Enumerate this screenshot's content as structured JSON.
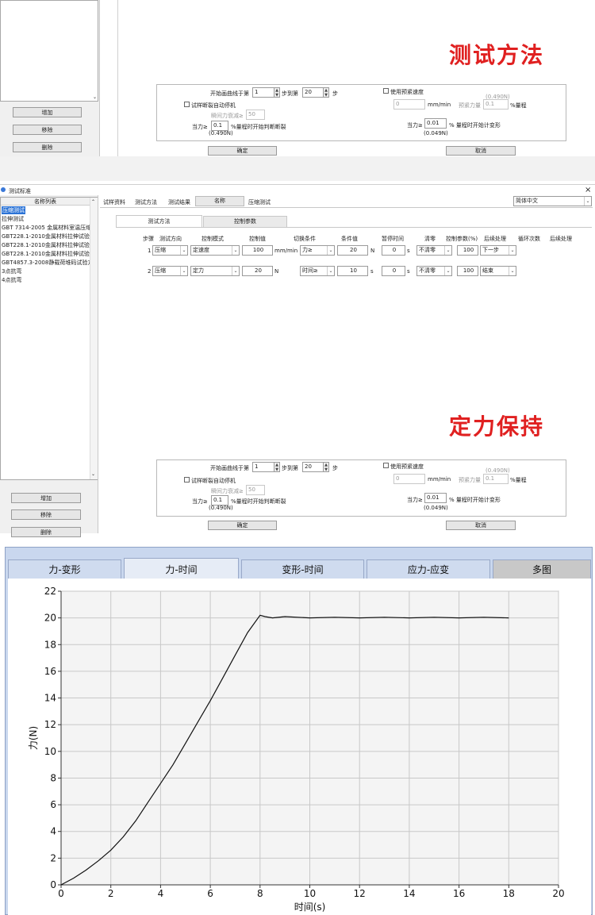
{
  "top": {
    "buttons": [
      "增加",
      "移除",
      "删除"
    ],
    "big_label": "测试方法",
    "curve_label_a": "开始画曲线于第",
    "curve_from": "1",
    "curve_label_b": "步到第",
    "curve_to": "20",
    "curve_label_c": "步",
    "use_preload": "使用预紧速度",
    "preload_hint": "(0.490N)",
    "preload_speed": "0",
    "preload_speed_unit": "mm/min",
    "preload_force_label": "预紧力量",
    "preload_force": "0.1",
    "preload_force_unit": "%量程",
    "break_stop": "试样断裂自动停机",
    "instant_drop_label": "瞬间力衰减≥",
    "instant_drop": "50",
    "force_ge_label": "当力≥",
    "force_ge": "0.1",
    "force_ge_text": "%量程时开始判断断裂",
    "force_ge_hint": "(0.490N)",
    "def_ge_label": "当力≥",
    "def_ge": "0.01",
    "def_ge_text": "% 量程时开始计变形",
    "def_ge_hint": "(0.049N)",
    "ok": "确定",
    "cancel": "取消"
  },
  "win": {
    "title": "测试标准",
    "close": "×",
    "list_header": "名称列表",
    "items": [
      "压缩测试",
      "拉伸测试",
      "GBT 7314-2005 金属材料室温压缩",
      "GBT228.1-2010金属材料拉伸试验",
      "GBT228.1-2010金属材料拉伸试验",
      "GBT228.1-2010金属材料拉伸试验",
      "GBT4857.3-2008静载荷堆码试验方",
      "3点抗弯",
      "4点抗弯"
    ],
    "tabs": [
      "试样资料",
      "测试方法",
      "测试结果"
    ],
    "name_label": "名称",
    "name_value": "压缩测试",
    "language": "简体中文",
    "subtabs": [
      "测试方法",
      "控制参数"
    ],
    "col_headers": [
      "步骤",
      "测试方向",
      "控制模式",
      "控制值",
      "切换条件",
      "条件值",
      "暂停时间",
      "清零",
      "控制参数(%)",
      "后续处理",
      "循环次数",
      "后续处理"
    ],
    "rows": [
      {
        "step": "1",
        "dir": "压缩",
        "mode": "定速度",
        "val": "100",
        "unit": "mm/min",
        "cond": "力≥",
        "cval": "20",
        "cunit": "N",
        "pause": "0",
        "punit": "s",
        "zero": "不清零",
        "param": "100",
        "next": "下一步"
      },
      {
        "step": "2",
        "dir": "压缩",
        "mode": "定力",
        "val": "20",
        "unit": "N",
        "cond": "时间≥",
        "cval": "10",
        "cunit": "s",
        "pause": "0",
        "punit": "s",
        "zero": "不清零",
        "param": "100",
        "next": "结束"
      }
    ],
    "big_label": "定力保持",
    "buttons": [
      "增加",
      "移除",
      "删除"
    ]
  },
  "chart_tabs": [
    "力-变形",
    "力-时间",
    "变形-时间",
    "应力-应变",
    "多图"
  ],
  "chart_data": {
    "type": "line",
    "xlabel": "时间(s)",
    "ylabel": "力(N)",
    "xlim": [
      0,
      20
    ],
    "ylim": [
      0,
      22
    ],
    "xticks": [
      0,
      2,
      4,
      6,
      8,
      10,
      12,
      14,
      16,
      18,
      20
    ],
    "yticks": [
      0,
      2,
      4,
      6,
      8,
      10,
      12,
      14,
      16,
      18,
      20,
      22
    ],
    "grid": true,
    "series": [
      {
        "x": [
          0,
          0.5,
          1,
          1.5,
          2,
          2.5,
          3,
          3.5,
          4,
          4.5,
          5,
          5.5,
          6,
          6.5,
          7,
          7.5,
          8,
          8.2,
          8.5,
          9,
          10,
          11,
          12,
          13,
          14,
          15,
          16,
          17,
          18
        ],
        "y": [
          0,
          0.5,
          1.1,
          1.8,
          2.6,
          3.6,
          4.8,
          6.2,
          7.6,
          9.0,
          10.6,
          12.2,
          13.8,
          15.5,
          17.2,
          18.9,
          20.2,
          20.1,
          20.0,
          20.1,
          20.0,
          20.05,
          20.0,
          20.05,
          20.0,
          20.05,
          20.0,
          20.05,
          20.0
        ]
      }
    ]
  }
}
